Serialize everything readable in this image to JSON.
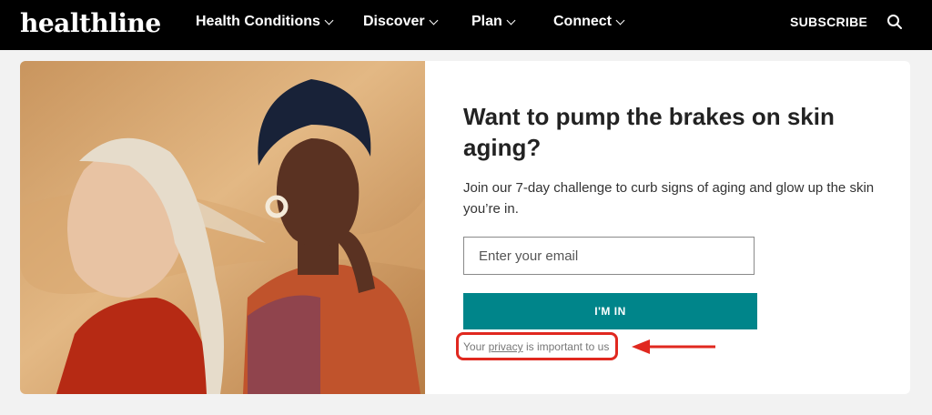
{
  "nav": {
    "logo": "healthline",
    "items": [
      {
        "label": "Health Conditions"
      },
      {
        "label": "Discover"
      },
      {
        "label": "Plan"
      },
      {
        "label": "Connect"
      }
    ],
    "subscribe": "SUBSCRIBE"
  },
  "promo": {
    "headline": "Want to pump the brakes on skin aging?",
    "subtext": "Join our 7-day challenge to curb signs of aging and glow up the skin you’re in.",
    "email_placeholder": "Enter your email",
    "button_label": "I'M IN",
    "privacy_pre": "Your ",
    "privacy_link": "privacy",
    "privacy_post": " is important to us"
  },
  "colors": {
    "nav_bg": "#000000",
    "button": "#00858a",
    "annotation": "#e0281f"
  }
}
